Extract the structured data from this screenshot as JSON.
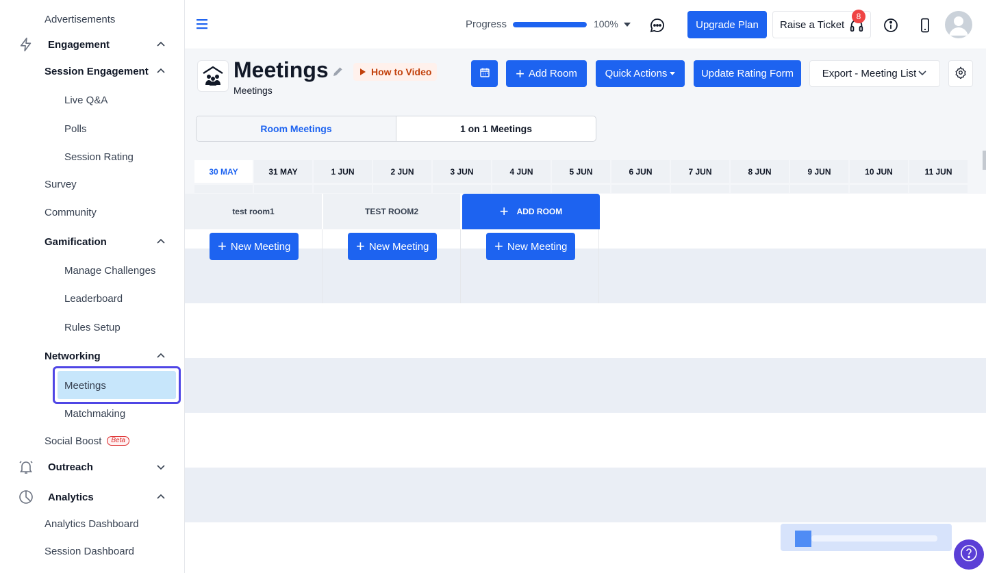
{
  "sidebar": {
    "items": [
      {
        "label": "Advertisements"
      },
      {
        "label": "Engagement"
      },
      {
        "label": "Session Engagement"
      },
      {
        "label": "Live Q&A"
      },
      {
        "label": "Polls"
      },
      {
        "label": "Session Rating"
      },
      {
        "label": "Survey"
      },
      {
        "label": "Community"
      },
      {
        "label": "Gamification"
      },
      {
        "label": "Manage Challenges"
      },
      {
        "label": "Leaderboard"
      },
      {
        "label": "Rules Setup"
      },
      {
        "label": "Networking"
      },
      {
        "label": "Meetings"
      },
      {
        "label": "Matchmaking"
      },
      {
        "label": "Social Boost",
        "badge": "Beta"
      },
      {
        "label": "Outreach"
      },
      {
        "label": "Analytics"
      },
      {
        "label": "Analytics Dashboard"
      },
      {
        "label": "Session Dashboard"
      }
    ],
    "active_item": "Meetings"
  },
  "topbar": {
    "progress_label": "Progress",
    "progress_value": 100,
    "progress_text": "100%",
    "upgrade_label": "Upgrade Plan",
    "ticket_label": "Raise a Ticket",
    "ticket_badge": "8"
  },
  "header": {
    "title": "Meetings",
    "subtitle": "Meetings",
    "howto_label": "How to Video",
    "add_room_label": "Add Room",
    "quick_actions_label": "Quick Actions",
    "update_rating_label": "Update Rating Form",
    "export_label": "Export - Meeting List"
  },
  "tabs": [
    {
      "label": "Room Meetings",
      "active": true
    },
    {
      "label": "1 on 1 Meetings",
      "active": false
    }
  ],
  "dates": [
    "30 MAY",
    "31 MAY",
    "1 JUN",
    "2 JUN",
    "3 JUN",
    "4 JUN",
    "5 JUN",
    "6 JUN",
    "7 JUN",
    "8 JUN",
    "9 JUN",
    "10 JUN",
    "11 JUN"
  ],
  "active_date": "30 MAY",
  "rooms": [
    {
      "name": "test room1",
      "new_meeting_label": "New Meeting"
    },
    {
      "name": "TEST ROOM2",
      "new_meeting_label": "New Meeting"
    }
  ],
  "add_room_column": {
    "label": "ADD ROOM",
    "new_meeting_label": "New Meeting"
  },
  "colors": {
    "primary": "#1d63f0",
    "highlight_outline": "#4f46e5",
    "active_fill": "#c7e6fb",
    "help": "#5b3fd6"
  }
}
